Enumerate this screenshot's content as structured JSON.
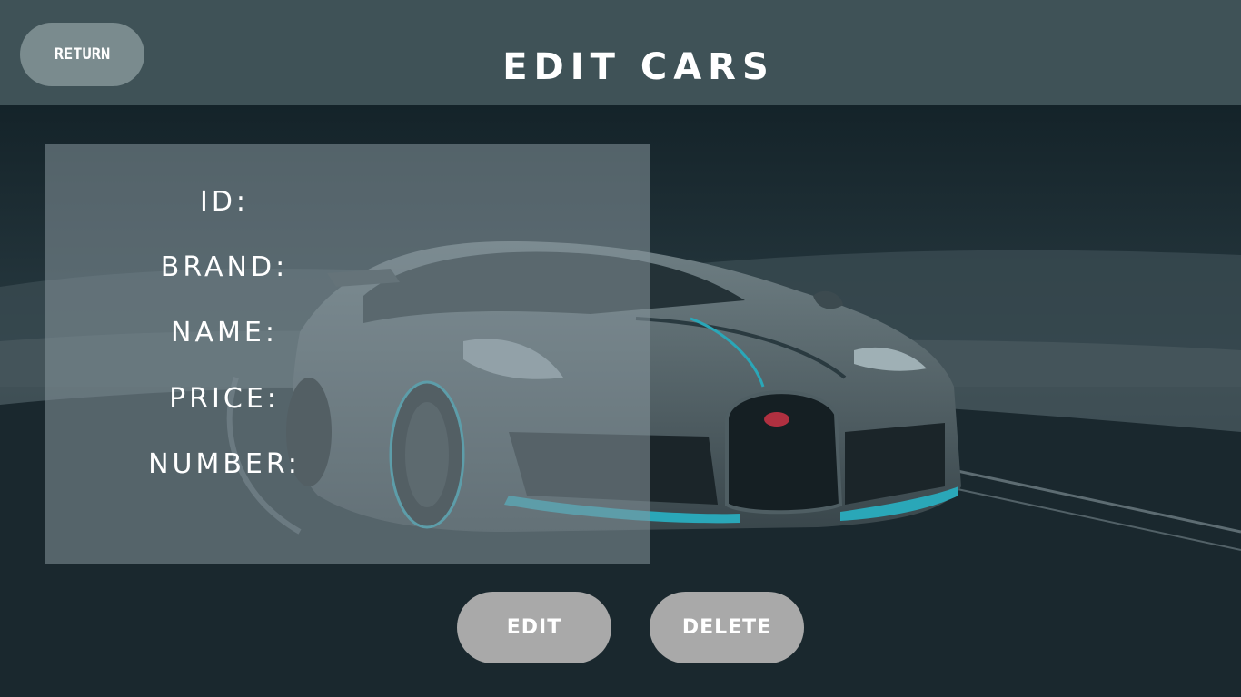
{
  "header": {
    "title": "EDIT CARS",
    "return_label": "RETURN"
  },
  "form": {
    "fields": [
      {
        "label": "ID:"
      },
      {
        "label": "BRAND:"
      },
      {
        "label": "NAME:"
      },
      {
        "label": "PRICE:"
      },
      {
        "label": "NUMBER:"
      }
    ]
  },
  "actions": {
    "edit_label": "EDIT",
    "delete_label": "DELETE"
  },
  "colors": {
    "header_bg": "#3f5257",
    "return_bg": "#7a8b8e",
    "action_bg": "#a9a9a9",
    "car_accent": "#2aa7b8"
  }
}
